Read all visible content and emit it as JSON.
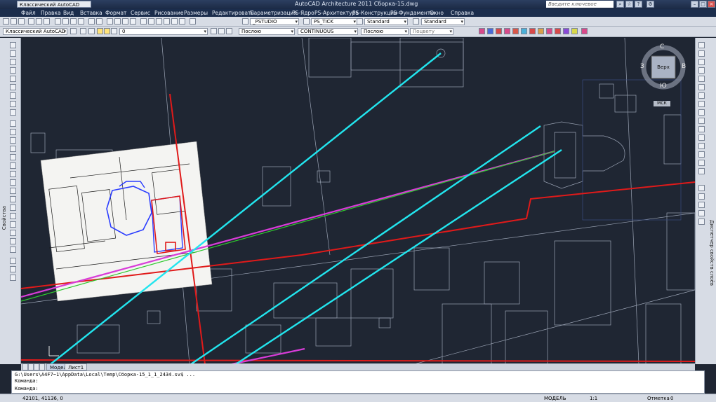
{
  "window": {
    "title": "AutoCAD Architecture 2011   Сборка-15.dwg",
    "workspace": "Классический AutoCAD",
    "search_placeholder": "Введите ключевое слово/фразу"
  },
  "menu": {
    "items": [
      "Файл",
      "Правка",
      "Вид",
      "Вставка",
      "Формат",
      "Сервис",
      "Рисование",
      "Размеры",
      "Редактировать",
      "Параметризация",
      "PS-Ядро",
      "PS-Архитектура",
      "PS-Конструкции",
      "PS-Фундаменты",
      "Окно",
      "Справка"
    ]
  },
  "toolbar_row2": {
    "text_style": "_PSTUDIO",
    "dim_style": "PS_TICK",
    "table_style": "Standard",
    "mleader_style": "Standard"
  },
  "toolbar_row3": {
    "workspace": "Классический AutoCAD",
    "layer": "0",
    "color": "Послою",
    "linetype": "CONTINUOUS",
    "lineweight": "Послою",
    "plotstyle": "Поцвету"
  },
  "viewcube": {
    "top_label": "Верх",
    "north": "С",
    "south": "Ю",
    "west": "З",
    "east": "В",
    "ucs": "МСК"
  },
  "palettes": {
    "left_label": "Свойства",
    "right_label": "Диспетчер свойств слоёв"
  },
  "tabs": {
    "model": "Модель",
    "sheet": "Лист1"
  },
  "command": {
    "line1": "G:\\Users\\A4F7~1\\AppData\\Local\\Temp\\Сборка-15_1_1_2434.sv$ ...",
    "line2": "Команда:",
    "line3": "Команда:"
  },
  "status": {
    "coords": "42101, 41136, 0",
    "model": "МОДЕЛЬ",
    "scale": "1:1",
    "workspace": "Отметка",
    "zero": "0"
  },
  "colors": {
    "background": "#1f2633",
    "cyan": "#22e5ee",
    "magenta": "#d83cd8",
    "red": "#e01a1a",
    "green": "#2ec82e",
    "blue_plan": "#2a3cff"
  }
}
